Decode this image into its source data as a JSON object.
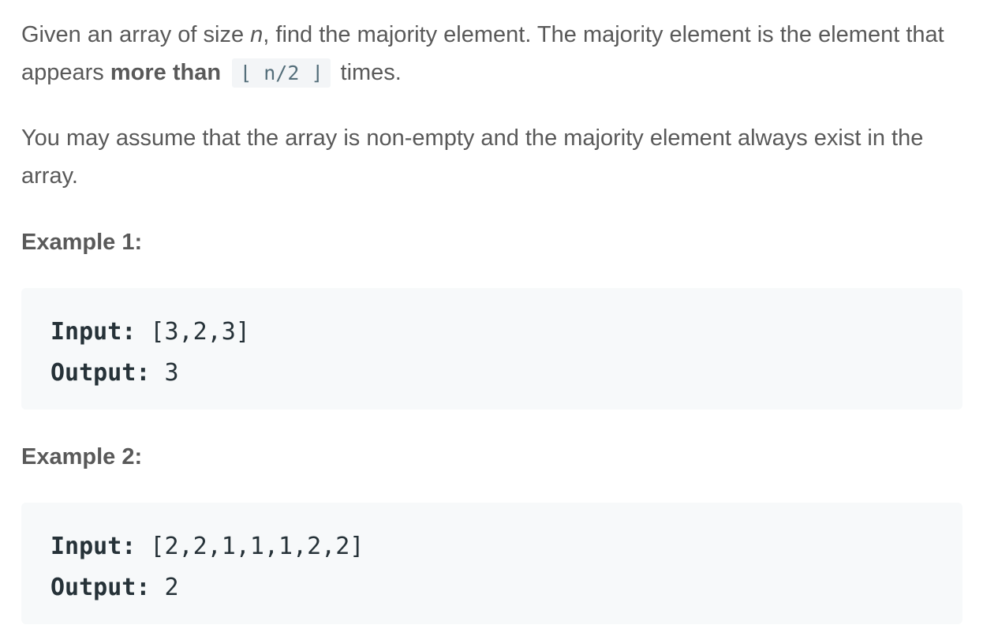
{
  "description": {
    "p1_part1": "Given an array of size ",
    "p1_var": "n",
    "p1_part2": ", find the majority element. The majority element is the element that appears ",
    "p1_bold": "more than",
    "p1_code": "⌊ n/2 ⌋",
    "p1_part3": " times.",
    "p2": "You may assume that the array is non-empty and the majority element always exist in the array."
  },
  "examples": [
    {
      "heading": "Example 1:",
      "input_label": "Input:",
      "input_value": " [3,2,3]",
      "output_label": "Output:",
      "output_value": " 3"
    },
    {
      "heading": "Example 2:",
      "input_label": "Input:",
      "input_value": " [2,2,1,1,1,2,2]",
      "output_label": "Output:",
      "output_value": " 2"
    }
  ]
}
